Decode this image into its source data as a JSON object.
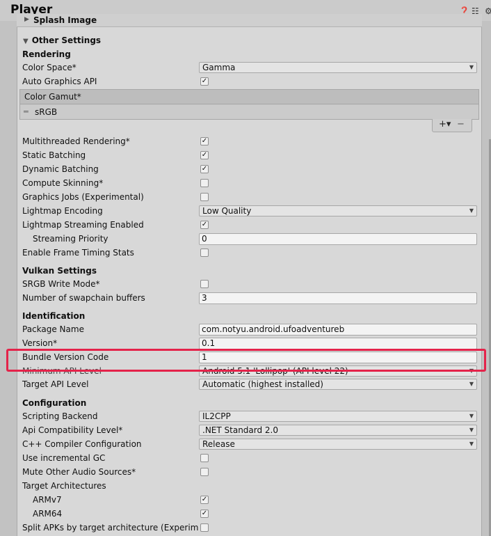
{
  "window": {
    "title": "Player"
  },
  "header_icons": [
    "help-icon",
    "preset-icon",
    "settings-icon"
  ],
  "splash": {
    "label": "Splash Image"
  },
  "other_settings": {
    "label": "Other Settings"
  },
  "rendering": {
    "title": "Rendering",
    "color_space": {
      "label": "Color Space*",
      "value": "Gamma"
    },
    "auto_graphics": {
      "label": "Auto Graphics API",
      "checked": true
    },
    "color_gamut": {
      "header": "Color Gamut*",
      "item": "sRGB"
    },
    "multithreaded": {
      "label": "Multithreaded Rendering*",
      "checked": true
    },
    "static_batching": {
      "label": "Static Batching",
      "checked": true
    },
    "dynamic_batching": {
      "label": "Dynamic Batching",
      "checked": true
    },
    "compute_skinning": {
      "label": "Compute Skinning*",
      "checked": false
    },
    "graphics_jobs": {
      "label": "Graphics Jobs (Experimental)",
      "checked": false
    },
    "lightmap_encoding": {
      "label": "Lightmap Encoding",
      "value": "Low Quality"
    },
    "lightmap_streaming": {
      "label": "Lightmap Streaming Enabled",
      "checked": true
    },
    "streaming_priority": {
      "label": "Streaming Priority",
      "value": "0"
    },
    "frame_timing": {
      "label": "Enable Frame Timing Stats",
      "checked": false
    }
  },
  "vulkan": {
    "title": "Vulkan Settings",
    "srgb_write": {
      "label": "SRGB Write Mode*",
      "checked": false
    },
    "swapchain": {
      "label": "Number of swapchain buffers",
      "value": "3"
    }
  },
  "identification": {
    "title": "Identification",
    "package_name": {
      "label": "Package Name",
      "value": "com.notyu.android.ufoadventureb"
    },
    "version": {
      "label": "Version*",
      "value": "0.1"
    },
    "bundle_code": {
      "label": "Bundle Version Code",
      "value": "1"
    },
    "min_api": {
      "label": "Minimum API Level",
      "value": "Android 5.1 'Lollipop' (API level 22)"
    },
    "target_api": {
      "label": "Target API Level",
      "value": "Automatic (highest installed)"
    }
  },
  "configuration": {
    "title": "Configuration",
    "scripting_backend": {
      "label": "Scripting Backend",
      "value": "IL2CPP"
    },
    "api_compat": {
      "label": "Api Compatibility Level*",
      "value": ".NET Standard 2.0"
    },
    "cpp_config": {
      "label": "C++ Compiler Configuration",
      "value": "Release"
    },
    "incremental_gc": {
      "label": "Use incremental GC",
      "checked": false
    },
    "mute_audio": {
      "label": "Mute Other Audio Sources*",
      "checked": false
    },
    "target_arch": {
      "label": "Target Architectures"
    },
    "armv7": {
      "label": "ARMv7",
      "checked": true
    },
    "arm64": {
      "label": "ARM64",
      "checked": true
    },
    "split_apks": {
      "label": "Split APKs by target architecture (Experimental)",
      "checked": false
    }
  },
  "colors": {
    "highlight": "#e4234a"
  }
}
